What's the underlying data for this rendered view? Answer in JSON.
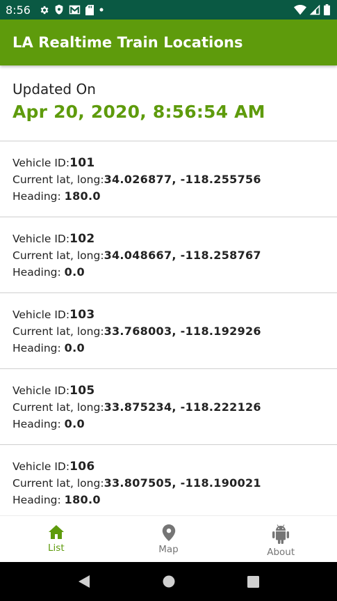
{
  "status_bar": {
    "time": "8:56",
    "icons": [
      "gear-icon",
      "shield-icon",
      "gmail-icon",
      "sd-card-icon",
      "dot-icon"
    ],
    "right_icons": [
      "wifi-icon",
      "signal-icon",
      "battery-icon"
    ],
    "color": "#0a5943"
  },
  "app_bar": {
    "title": "LA Realtime Train Locations",
    "color": "#5e9b0c"
  },
  "updated": {
    "label": "Updated On",
    "value": "Apr 20, 2020, 8:56:54 AM"
  },
  "vehicles": [
    {
      "id_label": "Vehicle ID:",
      "id": "101",
      "latlong_label": "Current lat, long:",
      "latlong": "34.026877, -118.255756",
      "heading_label": "Heading: ",
      "heading": "180.0"
    },
    {
      "id_label": "Vehicle ID:",
      "id": "102",
      "latlong_label": "Current lat, long:",
      "latlong": "34.048667, -118.258767",
      "heading_label": "Heading: ",
      "heading": "0.0"
    },
    {
      "id_label": "Vehicle ID:",
      "id": "103",
      "latlong_label": "Current lat, long:",
      "latlong": "33.768003, -118.192926",
      "heading_label": "Heading: ",
      "heading": "0.0"
    },
    {
      "id_label": "Vehicle ID:",
      "id": "105",
      "latlong_label": "Current lat, long:",
      "latlong": "33.875234, -118.222126",
      "heading_label": "Heading: ",
      "heading": "0.0"
    },
    {
      "id_label": "Vehicle ID:",
      "id": "106",
      "latlong_label": "Current lat, long:",
      "latlong": "33.807505, -118.190021",
      "heading_label": "Heading: ",
      "heading": "180.0"
    }
  ],
  "bottom_nav": {
    "items": [
      {
        "label": "List",
        "icon": "home-icon",
        "active": true
      },
      {
        "label": "Map",
        "icon": "map-pin-icon",
        "active": false
      },
      {
        "label": "About",
        "icon": "android-icon",
        "active": false
      }
    ],
    "active_color": "#5e9b0c"
  },
  "system_nav": {
    "icons": [
      "back-icon",
      "home-circle-icon",
      "recents-icon"
    ]
  }
}
